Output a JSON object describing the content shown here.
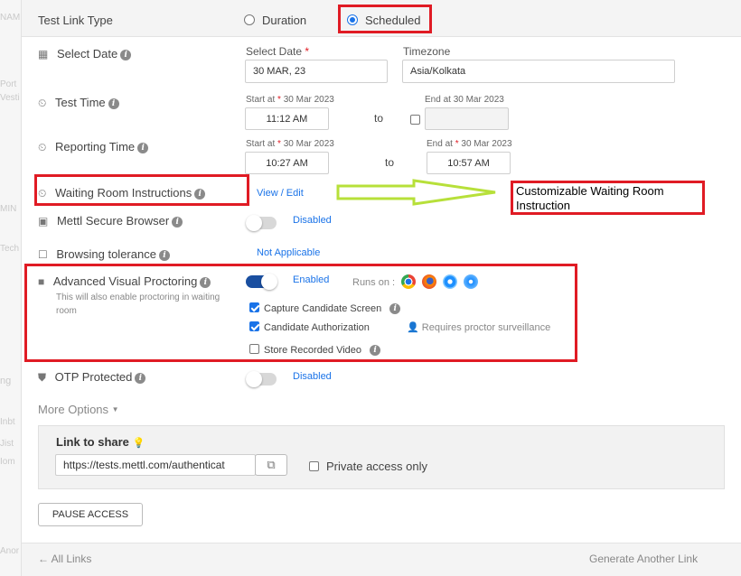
{
  "left_strip": [
    "NAM",
    "Port",
    "Vesti",
    "MIN",
    "Tech",
    "ng",
    "Inbt",
    "Jist",
    "Iom",
    "Anor"
  ],
  "test_link_type": {
    "label": "Test Link Type",
    "options": [
      {
        "label": "Duration",
        "selected": false
      },
      {
        "label": "Scheduled",
        "selected": true
      }
    ]
  },
  "select_date": {
    "label": "Select Date",
    "date_label": "Select Date",
    "required_mark": "*",
    "date_value": "30 MAR, 23",
    "timezone_label": "Timezone",
    "timezone_value": "Asia/Kolkata"
  },
  "test_time": {
    "label": "Test Time",
    "start_label": "Start at",
    "required_mark": "*",
    "start_date": "30 Mar 2023",
    "start_value": "11:12 AM",
    "to": "to",
    "end_label": "End at 30 Mar 2023",
    "end_value": ""
  },
  "reporting_time": {
    "label": "Reporting Time",
    "start_label": "Start at",
    "required_mark": "*",
    "start_date": "30 Mar 2023",
    "start_value": "10:27 AM",
    "to": "to",
    "end_label": "End at",
    "end_date": "30 Mar 2023",
    "end_value": "10:57 AM"
  },
  "waiting_room": {
    "label": "Waiting Room Instructions",
    "action": "View / Edit"
  },
  "annotation": {
    "text": "Customizable Waiting Room Instruction"
  },
  "secure_browser": {
    "label": "Mettl Secure Browser",
    "status": "Disabled",
    "enabled": false
  },
  "browsing_tolerance": {
    "label": "Browsing tolerance",
    "status": "Not Applicable"
  },
  "proctoring": {
    "label": "Advanced Visual Proctoring",
    "note": "This will also enable proctoring in waiting room",
    "status": "Enabled",
    "enabled": true,
    "runs_on": "Runs on :",
    "browsers": [
      "chrome-icon",
      "firefox-icon",
      "ie-icon",
      "safari-icon"
    ],
    "options": [
      {
        "label": "Capture Candidate Screen",
        "checked": true
      },
      {
        "label": "Candidate Authorization",
        "checked": true
      },
      {
        "label": "Store Recorded Video",
        "checked": false
      }
    ],
    "proctor_note": "Requires proctor surveillance"
  },
  "otp": {
    "label": "OTP Protected",
    "status": "Disabled",
    "enabled": false
  },
  "more_options": "More Options",
  "share": {
    "title": "Link to share",
    "url": "https://tests.mettl.com/authenticat",
    "private_label": "Private access only"
  },
  "pause_button": "PAUSE ACCESS",
  "footer": {
    "back": "← All Links",
    "generate": "Generate Another Link"
  },
  "colors": {
    "accent": "#1a73e8",
    "annotation_red": "#e01b24",
    "arrow_green": "#b7e03a",
    "toggle_on": "#1a4fa0"
  }
}
